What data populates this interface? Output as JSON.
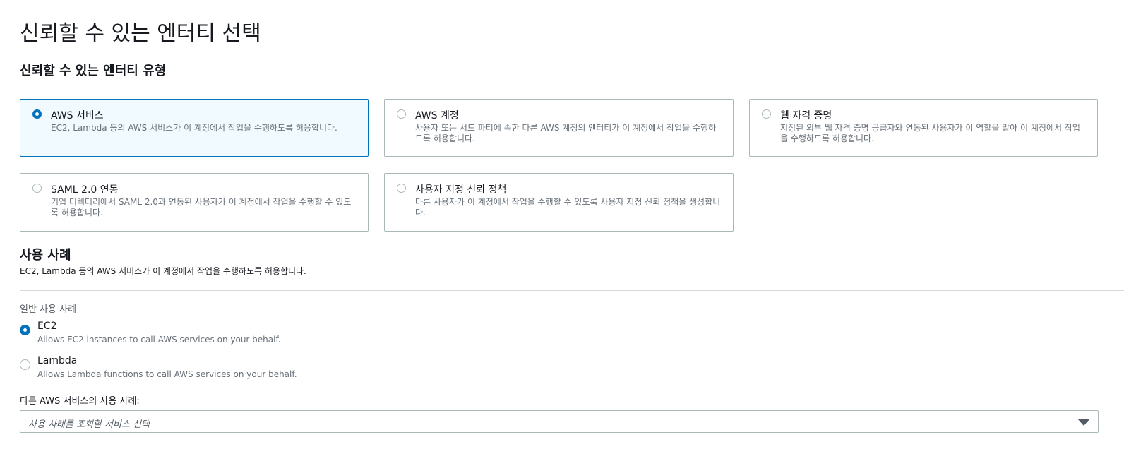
{
  "page_title": "신뢰할 수 있는 엔터티 선택",
  "entity_type_heading": "신뢰할 수 있는 엔터티 유형",
  "entity_types": [
    {
      "title": "AWS 서비스",
      "desc": "EC2, Lambda 등의 AWS 서비스가 이 계정에서 작업을 수행하도록 허용합니다.",
      "selected": true
    },
    {
      "title": "AWS 계정",
      "desc": "사용자 또는 서드 파티에 속한 다른 AWS 계정의 엔터티가 이 계정에서 작업을 수행하도록 허용합니다.",
      "selected": false
    },
    {
      "title": "웹 자격 증명",
      "desc": "지정된 외부 웹 자격 증명 공급자와 연동된 사용자가 이 역할을 맡아 이 계정에서 작업을 수행하도록 허용합니다.",
      "selected": false
    },
    {
      "title": "SAML 2.0 연동",
      "desc": "기업 디렉터리에서 SAML 2.0과 연동된 사용자가 이 계정에서 작업을 수행할 수 있도록 허용합니다.",
      "selected": false
    },
    {
      "title": "사용자 지정 신뢰 정책",
      "desc": "다른 사용자가 이 계정에서 작업을 수행할 수 있도록 사용자 지정 신뢰 정책을 생성합니다.",
      "selected": false
    }
  ],
  "use_case": {
    "heading": "사용 사례",
    "desc": "EC2, Lambda 등의 AWS 서비스가 이 계정에서 작업을 수행하도록 허용합니다.",
    "common_label": "일반 사용 사례",
    "options": [
      {
        "title": "EC2",
        "desc": "Allows EC2 instances to call AWS services on your behalf.",
        "selected": true
      },
      {
        "title": "Lambda",
        "desc": "Allows Lambda functions to call AWS services on your behalf.",
        "selected": false
      }
    ],
    "other_label": "다른 AWS 서비스의 사용 사례:",
    "select_placeholder": "사용 사례를 조회할 서비스 선택"
  }
}
